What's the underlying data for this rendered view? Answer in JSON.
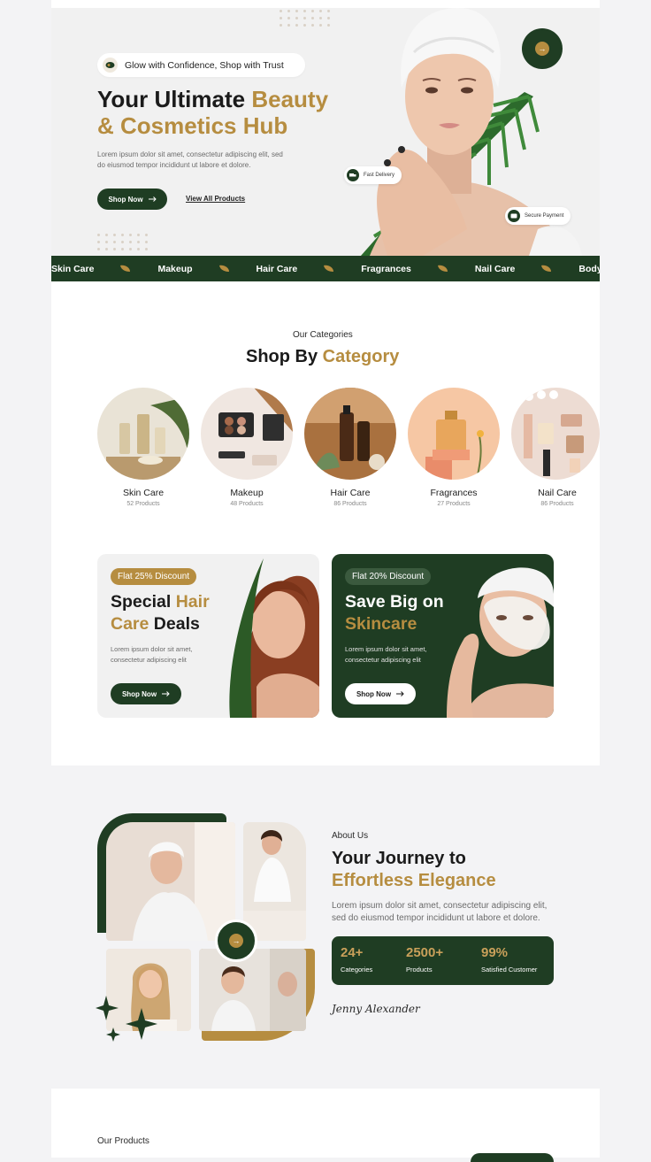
{
  "hero": {
    "tagline": "Glow with Confidence, Shop with Trust",
    "title_part1": "Your Ultimate ",
    "title_gold1": "Beauty",
    "title_gold2": "& Cosmetics Hub",
    "description": "Lorem ipsum dolor sit amet, consectetur adipiscing elit, sed do eiusmod tempor incididunt ut labore et dolore.",
    "shop_now": "Shop Now",
    "view_all": "View All Products",
    "chip_delivery": "Fast Delivery",
    "chip_payment": "Secure Payment"
  },
  "marquee": [
    "Skin Care",
    "Makeup",
    "Hair Care",
    "Fragrances",
    "Nail Care",
    "Body Care"
  ],
  "categories": {
    "eyebrow": "Our Categories",
    "title_part1": "Shop By ",
    "title_gold": "Category",
    "items": [
      {
        "name": "Skin Care",
        "count": "52 Products"
      },
      {
        "name": "Makeup",
        "count": "48 Products"
      },
      {
        "name": "Hair Care",
        "count": "86 Products"
      },
      {
        "name": "Fragrances",
        "count": "27 Products"
      },
      {
        "name": "Nail Care",
        "count": "86 Products"
      }
    ]
  },
  "promos": [
    {
      "tag": "Flat 25% Discount",
      "title_a": "Special ",
      "title_gold": "Hair Care",
      "title_b": " Deals",
      "desc": "Lorem ipsum dolor sit amet, consectetur adipiscing elit",
      "button": "Shop Now"
    },
    {
      "tag": "Flat 20% Discount",
      "title_a": "Save Big on ",
      "title_gold": "Skincare",
      "desc": "Lorem ipsum dolor sit amet, consectetur adipiscing elit",
      "button": "Shop Now"
    }
  ],
  "about": {
    "eyebrow": "About Us",
    "title_line1": "Your Journey to",
    "title_gold": "Effortless Elegance",
    "description": "Lorem ipsum dolor sit amet, consectetur adipiscing elit, sed do eiusmod tempor incididunt ut labore et dolore.",
    "stats": [
      {
        "value": "24+",
        "label": "Categories"
      },
      {
        "value": "2500+",
        "label": "Products"
      },
      {
        "value": "99%",
        "label": "Satisfied Customer"
      }
    ],
    "signature": "Jenny Alexander"
  },
  "products": {
    "eyebrow": "Our Products"
  },
  "colors": {
    "green": "#1f3d23",
    "gold": "#b68d40",
    "background": "#f3f3f5"
  }
}
